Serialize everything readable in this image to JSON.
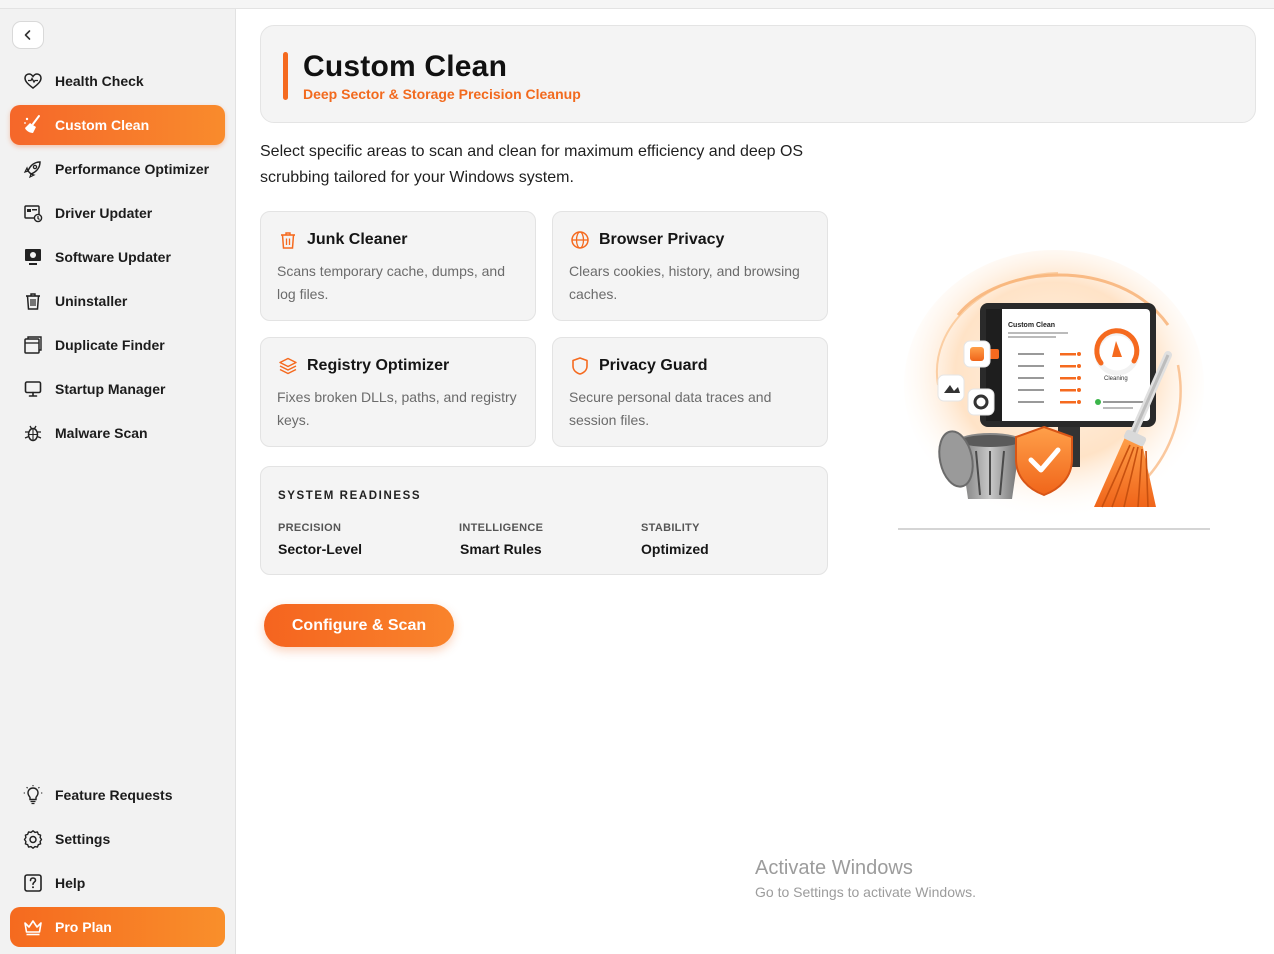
{
  "sidebar": {
    "back_icon": "chevron-left-icon",
    "items": [
      {
        "label": "Health Check",
        "icon": "heart-pulse-icon"
      },
      {
        "label": "Custom Clean",
        "icon": "broom-icon",
        "active": true
      },
      {
        "label": "Performance Optimizer",
        "icon": "rocket-icon"
      },
      {
        "label": "Driver Updater",
        "icon": "driver-icon"
      },
      {
        "label": "Software Updater",
        "icon": "monitor-update-icon"
      },
      {
        "label": "Uninstaller",
        "icon": "trash-icon"
      },
      {
        "label": "Duplicate Finder",
        "icon": "duplicate-icon"
      },
      {
        "label": "Startup Manager",
        "icon": "monitor-icon"
      },
      {
        "label": "Malware Scan",
        "icon": "bug-icon"
      }
    ],
    "bottom_items": [
      {
        "label": "Feature Requests",
        "icon": "lightbulb-icon"
      },
      {
        "label": "Settings",
        "icon": "gear-icon"
      },
      {
        "label": "Help",
        "icon": "help-icon"
      },
      {
        "label": "Pro Plan",
        "icon": "crown-icon"
      }
    ]
  },
  "header": {
    "title": "Custom Clean",
    "subtitle": "Deep Sector & Storage Precision Cleanup"
  },
  "intro": "Select specific areas to scan and clean for maximum efficiency and deep OS scrubbing tailored for your Windows system.",
  "cards": [
    {
      "title": "Junk Cleaner",
      "desc": "Scans temporary cache, dumps, and log files.",
      "icon": "trash-icon"
    },
    {
      "title": "Browser Privacy",
      "desc": "Clears cookies, history, and browsing caches.",
      "icon": "globe-icon"
    },
    {
      "title": "Registry Optimizer",
      "desc": "Fixes broken DLLs, paths, and registry keys.",
      "icon": "layers-icon"
    },
    {
      "title": "Privacy Guard",
      "desc": "Secure personal data traces and session files.",
      "icon": "shield-icon"
    }
  ],
  "readiness": {
    "title": "SYSTEM READINESS",
    "stats": [
      {
        "label": "PRECISION",
        "value": "Sector-Level"
      },
      {
        "label": "INTELLIGENCE",
        "value": "Smart Rules"
      },
      {
        "label": "STABILITY",
        "value": "Optimized"
      }
    ]
  },
  "cta_label": "Configure & Scan",
  "illustration": {
    "screen_title": "Custom Clean",
    "gauge_label": "Cleaning"
  },
  "watermark": {
    "line1": "Activate Windows",
    "line2": "Go to Settings to activate Windows."
  },
  "colors": {
    "accent": "#f56a1f",
    "accent_light": "#f98b2c",
    "sidebar_bg": "#f2f2f2",
    "card_bg": "#f4f4f4"
  }
}
